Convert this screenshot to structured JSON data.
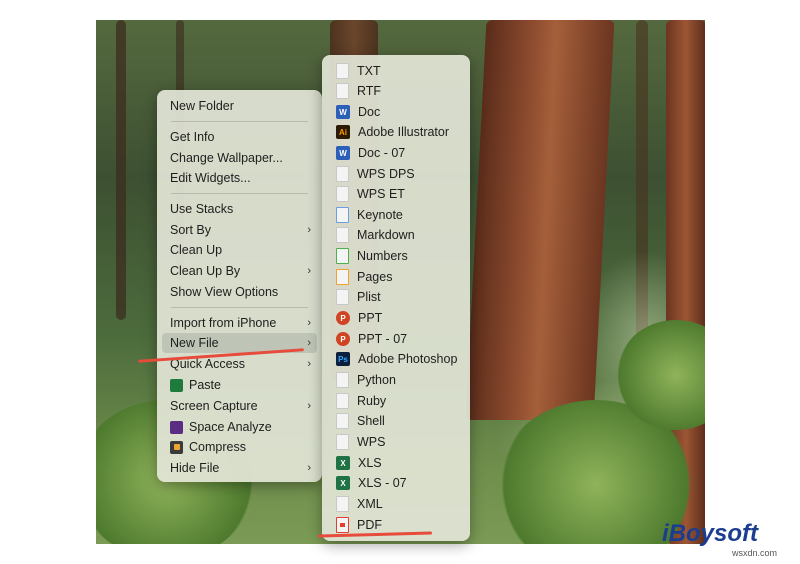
{
  "main_menu": {
    "items": [
      {
        "label": "New Folder"
      },
      {
        "label": "Get Info"
      },
      {
        "label": "Change Wallpaper..."
      },
      {
        "label": "Edit Widgets..."
      },
      {
        "label": "Use Stacks"
      },
      {
        "label": "Sort By",
        "submenu": true
      },
      {
        "label": "Clean Up"
      },
      {
        "label": "Clean Up By",
        "submenu": true
      },
      {
        "label": "Show View Options"
      },
      {
        "label": "Import from iPhone",
        "submenu": true
      },
      {
        "label": "New File",
        "submenu": true,
        "highlighted": true
      },
      {
        "label": "Quick Access",
        "submenu": true
      },
      {
        "label": "Paste",
        "icon": "paste-icon"
      },
      {
        "label": "Screen Capture",
        "submenu": true
      },
      {
        "label": "Space Analyze",
        "icon": "space-analyze-icon"
      },
      {
        "label": "Compress",
        "icon": "compress-icon"
      },
      {
        "label": "Hide File",
        "submenu": true
      }
    ],
    "chevron": "›"
  },
  "sub_menu": {
    "items": [
      {
        "label": "TXT",
        "icon": "txt-file-icon"
      },
      {
        "label": "RTF",
        "icon": "rtf-file-icon"
      },
      {
        "label": "Doc",
        "icon": "word-doc-icon",
        "icon_text": "W",
        "color": "#2b5fb8"
      },
      {
        "label": "Adobe Illustrator",
        "icon": "illustrator-icon",
        "icon_text": "Ai",
        "color": "#2a1a06"
      },
      {
        "label": "Doc - 07",
        "icon": "word-doc-07-icon",
        "icon_text": "W",
        "color": "#2b5fb8"
      },
      {
        "label": "WPS DPS",
        "icon": "wps-dps-file-icon"
      },
      {
        "label": "WPS ET",
        "icon": "wps-et-file-icon"
      },
      {
        "label": "Keynote",
        "icon": "keynote-file-icon"
      },
      {
        "label": "Markdown",
        "icon": "markdown-file-icon"
      },
      {
        "label": "Numbers",
        "icon": "numbers-file-icon"
      },
      {
        "label": "Pages",
        "icon": "pages-file-icon"
      },
      {
        "label": "Plist",
        "icon": "plist-file-icon"
      },
      {
        "label": "PPT",
        "icon": "powerpoint-icon",
        "icon_text": "P",
        "color": "#d04423"
      },
      {
        "label": "PPT - 07",
        "icon": "powerpoint-07-icon",
        "icon_text": "P",
        "color": "#d04423"
      },
      {
        "label": "Adobe Photoshop",
        "icon": "photoshop-icon",
        "icon_text": "Ps",
        "color": "#0c1f3d"
      },
      {
        "label": "Python",
        "icon": "python-file-icon"
      },
      {
        "label": "Ruby",
        "icon": "ruby-file-icon"
      },
      {
        "label": "Shell",
        "icon": "shell-file-icon"
      },
      {
        "label": "WPS",
        "icon": "wps-file-icon"
      },
      {
        "label": "XLS",
        "icon": "excel-icon",
        "icon_text": "X",
        "color": "#1f7244"
      },
      {
        "label": "XLS - 07",
        "icon": "excel-07-icon",
        "icon_text": "X",
        "color": "#1f7244"
      },
      {
        "label": "XML",
        "icon": "xml-file-icon"
      },
      {
        "label": "PDF",
        "icon": "pdf-file-icon"
      }
    ]
  },
  "branding": {
    "logo": "iBoysoft",
    "watermark": "wsxdn.com"
  },
  "colors": {
    "underline": "#e64b3b",
    "menu_bg": "#e2e5d6",
    "logo": "#1a3d8f"
  }
}
